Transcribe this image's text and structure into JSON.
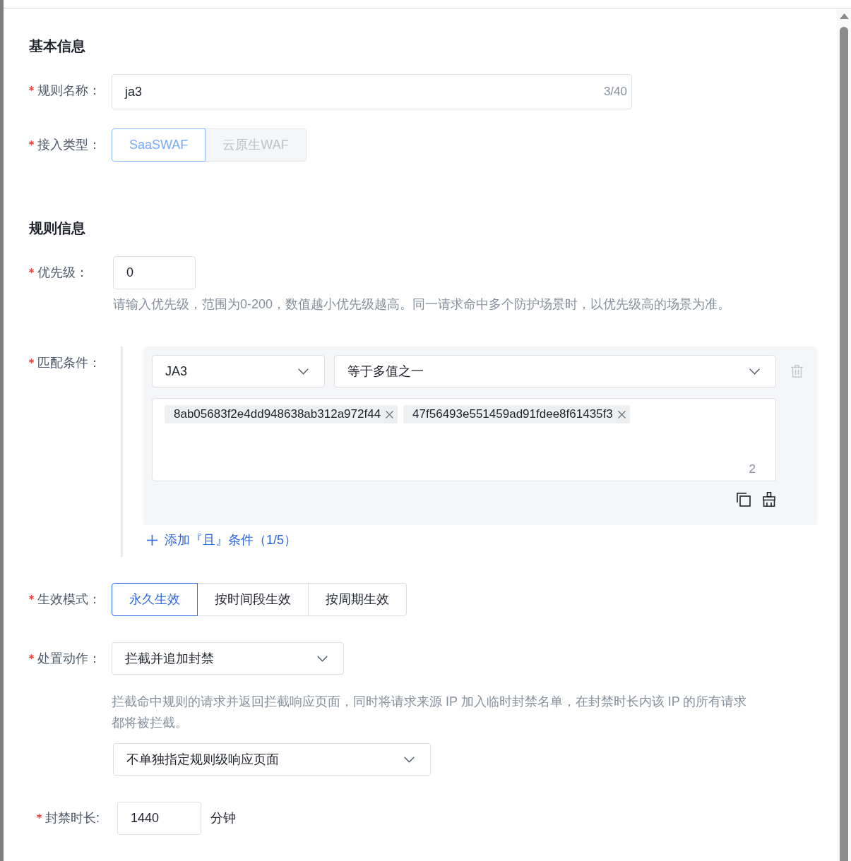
{
  "sections": [
    {
      "title": "基本信息",
      "fields": [
        {
          "kind": "text",
          "label": "规则名称：",
          "required": true,
          "value": "ja3",
          "counter": "3/40"
        },
        {
          "kind": "segmented",
          "label": "接入类型：",
          "required": true,
          "disabled": true,
          "options": [
            {
              "label": "SaaSWAF",
              "selected": true
            },
            {
              "label": "云原生WAF",
              "selected": false
            }
          ]
        }
      ]
    },
    {
      "title": "规则信息",
      "fields": [
        {
          "kind": "number",
          "label": "优先级：",
          "required": true,
          "value": "0",
          "help": "请输入优先级，范围为0-200，数值越小优先级越高。同一请求命中多个防护场景时，以优先级高的场景为准。"
        },
        {
          "kind": "conditions",
          "label": "匹配条件：",
          "required": true,
          "conditions": [
            {
              "field": "JA3",
              "operator": "等于多值之一",
              "values": [
                "8ab05683f2e4dd948638ab312a972f44",
                "47f56493e551459ad91fdee8f61435f3"
              ],
              "count": "2"
            }
          ],
          "add_condition": "添加『且』条件（1/5）"
        },
        {
          "kind": "segmented",
          "label": "生效模式：",
          "required": true,
          "disabled": false,
          "options": [
            {
              "label": "永久生效",
              "selected": true
            },
            {
              "label": "按时间段生效",
              "selected": false
            },
            {
              "label": "按周期生效",
              "selected": false
            }
          ]
        },
        {
          "kind": "select",
          "label": "处置动作：",
          "required": true,
          "value": "拦截并追加封禁",
          "help": "拦截命中规则的请求并返回拦截响应页面，同时将请求来源 IP 加入临时封禁名单，在封禁时长内该 IP 的所有请求都将被拦截。",
          "response_page_select": "不单独指定规则级响应页面"
        },
        {
          "kind": "number_unit",
          "label": "封禁时长:",
          "required": true,
          "value": "1440",
          "unit": "分钟"
        }
      ]
    }
  ]
}
